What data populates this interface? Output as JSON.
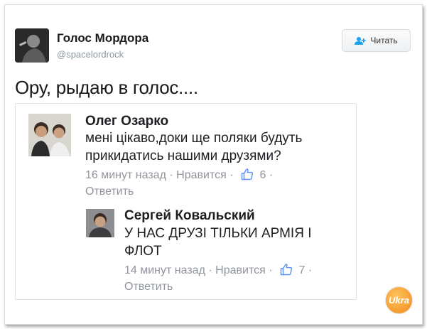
{
  "tweet": {
    "author_name": "Голос Мордора",
    "author_handle": "@spacelordrock",
    "follow_label": "Читать",
    "text": "Ору, рыдаю в голос...."
  },
  "embedded": {
    "comments": [
      {
        "name": "Олег Озарко",
        "text_line1": "мені цікаво,доки ще поляки будуть",
        "text_line2": "прикидатись нашими друзями?",
        "time": "16 минут назад",
        "like_label": "Нравится",
        "like_count": "6",
        "reply_label": "Ответить"
      },
      {
        "name": "Сергей Ковальский",
        "text_line1": "У НАС ДРУЗІ ТІЛЬКИ АРМІЯ І",
        "text_line2": "ФЛОТ",
        "time": "14 минут назад",
        "like_label": "Нравится",
        "like_count": "7",
        "reply_label": "Ответить"
      }
    ],
    "separator": "·"
  },
  "watermark": {
    "logo_text": "Ukra"
  },
  "colors": {
    "link": "#90949c",
    "like_icon": "#5890ff",
    "follow_icon": "#1da1f2"
  },
  "icons": [
    "follow-person-icon",
    "like-thumb-icon"
  ]
}
